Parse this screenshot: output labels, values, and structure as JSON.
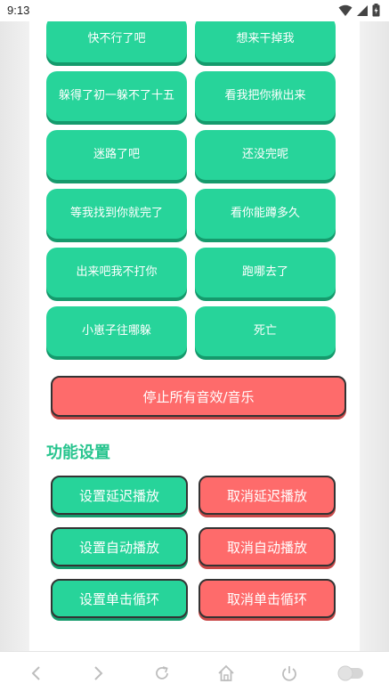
{
  "status": {
    "time": "9:13"
  },
  "sound_buttons": [
    {
      "label": "快不行了吧"
    },
    {
      "label": "想来干掉我"
    },
    {
      "label": "躲得了初一躲不了十五"
    },
    {
      "label": "看我把你揪出来"
    },
    {
      "label": "迷路了吧"
    },
    {
      "label": "还没完呢"
    },
    {
      "label": "等我找到你就完了"
    },
    {
      "label": "看你能蹲多久"
    },
    {
      "label": "出来吧我不打你"
    },
    {
      "label": "跑哪去了"
    },
    {
      "label": "小崽子往哪躲"
    },
    {
      "label": "死亡"
    }
  ],
  "stop_all_label": "停止所有音效/音乐",
  "settings": {
    "title": "功能设置",
    "set_delay": "设置延迟播放",
    "cancel_delay": "取消延迟播放",
    "set_auto": "设置自动播放",
    "cancel_auto": "取消自动播放",
    "set_loop": "设置单击循环",
    "cancel_loop": "取消单击循环"
  },
  "colors": {
    "green": "#27d49a",
    "red": "#fe6b6b",
    "title_green": "#27c48e"
  },
  "nav_icons": [
    "back-icon",
    "forward-icon",
    "refresh-icon",
    "home-icon",
    "power-icon",
    "toggle-icon"
  ]
}
